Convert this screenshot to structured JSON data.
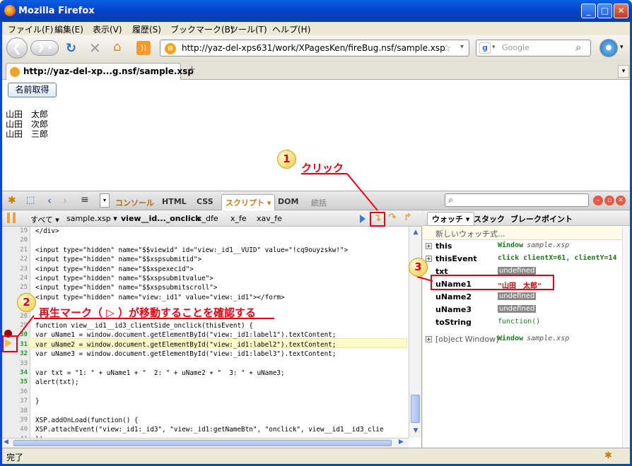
{
  "window": {
    "title": "Mozilla Firefox",
    "min": "_",
    "max": "□",
    "close": "✕"
  },
  "menu": [
    "ファイル(F)",
    "編集(E)",
    "表示(V)",
    "履歴(S)",
    "ブックマーク(B)",
    "ツール(T)",
    "ヘルプ(H)"
  ],
  "nav": {
    "url": "http://yaz-del-xps631/work/XPagesKen/fireBug.nsf/sample.xsp",
    "search_placeholder": "Google"
  },
  "tab": {
    "label": "http://yaz-del-xp...g.nsf/sample.xsp",
    "new_tab": "+"
  },
  "page": {
    "button": "名前取得",
    "names": [
      "山田　太郎",
      "山田　次郎",
      "山田　三郎"
    ]
  },
  "firebug": {
    "tabs": [
      "コンソール",
      "HTML",
      "CSS",
      "スクリプト ▾",
      "DOM",
      "統括"
    ],
    "source_bar": {
      "all": "すべて ▾",
      "file": "sample.xsp ▾",
      "func": "view__id..._onclick",
      "crumbs": [
        "x_dfe",
        "x_fe",
        "xav_fe"
      ]
    },
    "lines": [
      {
        "n": "19",
        "t": "</div>",
        "b": false
      },
      {
        "n": "20",
        "t": "",
        "b": false
      },
      {
        "n": "21",
        "t": "<input type=\"hidden\" name=\"$$viewid\" id=\"view:_id1__VUID\" value=\"!cq9ouyzskw!\">",
        "b": false
      },
      {
        "n": "22",
        "t": "<input type=\"hidden\" name=\"$$xspsubmitid\">",
        "b": false
      },
      {
        "n": "23",
        "t": "<input type=\"hidden\" name=\"$$xspexecid\">",
        "b": false
      },
      {
        "n": "24",
        "t": "<input type=\"hidden\" name=\"$$xspsubmitvalue\">",
        "b": false
      },
      {
        "n": "25",
        "t": "<input type=\"hidden\" name=\"$$xspsubmitscroll\">",
        "b": false
      },
      {
        "n": "26",
        "t": "<input type=\"hidden\" name=\"view:_id1\" value=\"view:_id1\"></form>",
        "b": false
      },
      {
        "n": "27",
        "t": "",
        "b": false
      },
      {
        "n": "28",
        "t": "",
        "b": false
      },
      {
        "n": "29",
        "t": "function view__id1__id3_clientSide_onclick(thisEvent) {",
        "b": false
      },
      {
        "n": "30",
        "t": "var uName1 = window.document.getElementById(\"view:_id1:label1\").textContent;",
        "b": true
      },
      {
        "n": "31",
        "t": "var uName2 = window.document.getElementById(\"view:_id1:label2\").textContent;",
        "b": true
      },
      {
        "n": "32",
        "t": "var uName3 = window.document.getElementById(\"view:_id1:label3\").textContent;",
        "b": true
      },
      {
        "n": "33",
        "t": "",
        "b": false
      },
      {
        "n": "34",
        "t": "var txt = \"1: \" + uName1 + \"  2: \" + uName2 + \"  3: \" + uName3;",
        "b": true
      },
      {
        "n": "35",
        "t": "alert(txt);",
        "b": true
      },
      {
        "n": "36",
        "t": "",
        "b": false
      },
      {
        "n": "37",
        "t": "}",
        "b": false
      },
      {
        "n": "38",
        "t": "",
        "b": false
      },
      {
        "n": "39",
        "t": "XSP.addOnLoad(function() {",
        "b": false
      },
      {
        "n": "40",
        "t": "XSP.attachEvent(\"view:_id1:_id3\", \"view:_id1:getNameBtn\", \"onclick\", view__id1__id3_clie",
        "b": false
      },
      {
        "n": "41",
        "t": "});",
        "b": false
      }
    ],
    "watch_tabs": [
      "ウォッチ ▾",
      "スタック",
      "ブレークポイント"
    ],
    "new_watch": "新しいウォッチ式...",
    "watch": [
      {
        "k": "this",
        "v": "Window",
        "v2": "sample.xsp",
        "exp": "+",
        "style": "green"
      },
      {
        "k": "thisEvent",
        "v": "click clientX=61, clientY=14",
        "v2": "",
        "exp": "+",
        "style": "green"
      },
      {
        "k": "txt",
        "v": "undefined",
        "v2": "",
        "exp": "",
        "style": "undef"
      },
      {
        "k": "uName1",
        "v": "\"山田　太郎\"",
        "v2": "",
        "exp": "",
        "style": "red"
      },
      {
        "k": "uName2",
        "v": "undefined",
        "v2": "",
        "exp": "",
        "style": "undef"
      },
      {
        "k": "uName3",
        "v": "undefined",
        "v2": "",
        "exp": "",
        "style": "undef"
      },
      {
        "k": "toString",
        "v": "function()",
        "v2": "",
        "exp": "",
        "style": "green-fn"
      },
      {
        "k": "[object Window]",
        "v": "Window",
        "v2": "sample.xsp",
        "exp": "+",
        "style": "obj"
      }
    ]
  },
  "annotations": {
    "n1": "1",
    "t1": "クリック",
    "n2": "2",
    "t2": "再生マーク（ ▷ ）が移動することを確認する",
    "n3": "3"
  },
  "status": "完了",
  "colors": {
    "accent_red": "#e60012",
    "titlebar": "#0a5fe6"
  }
}
